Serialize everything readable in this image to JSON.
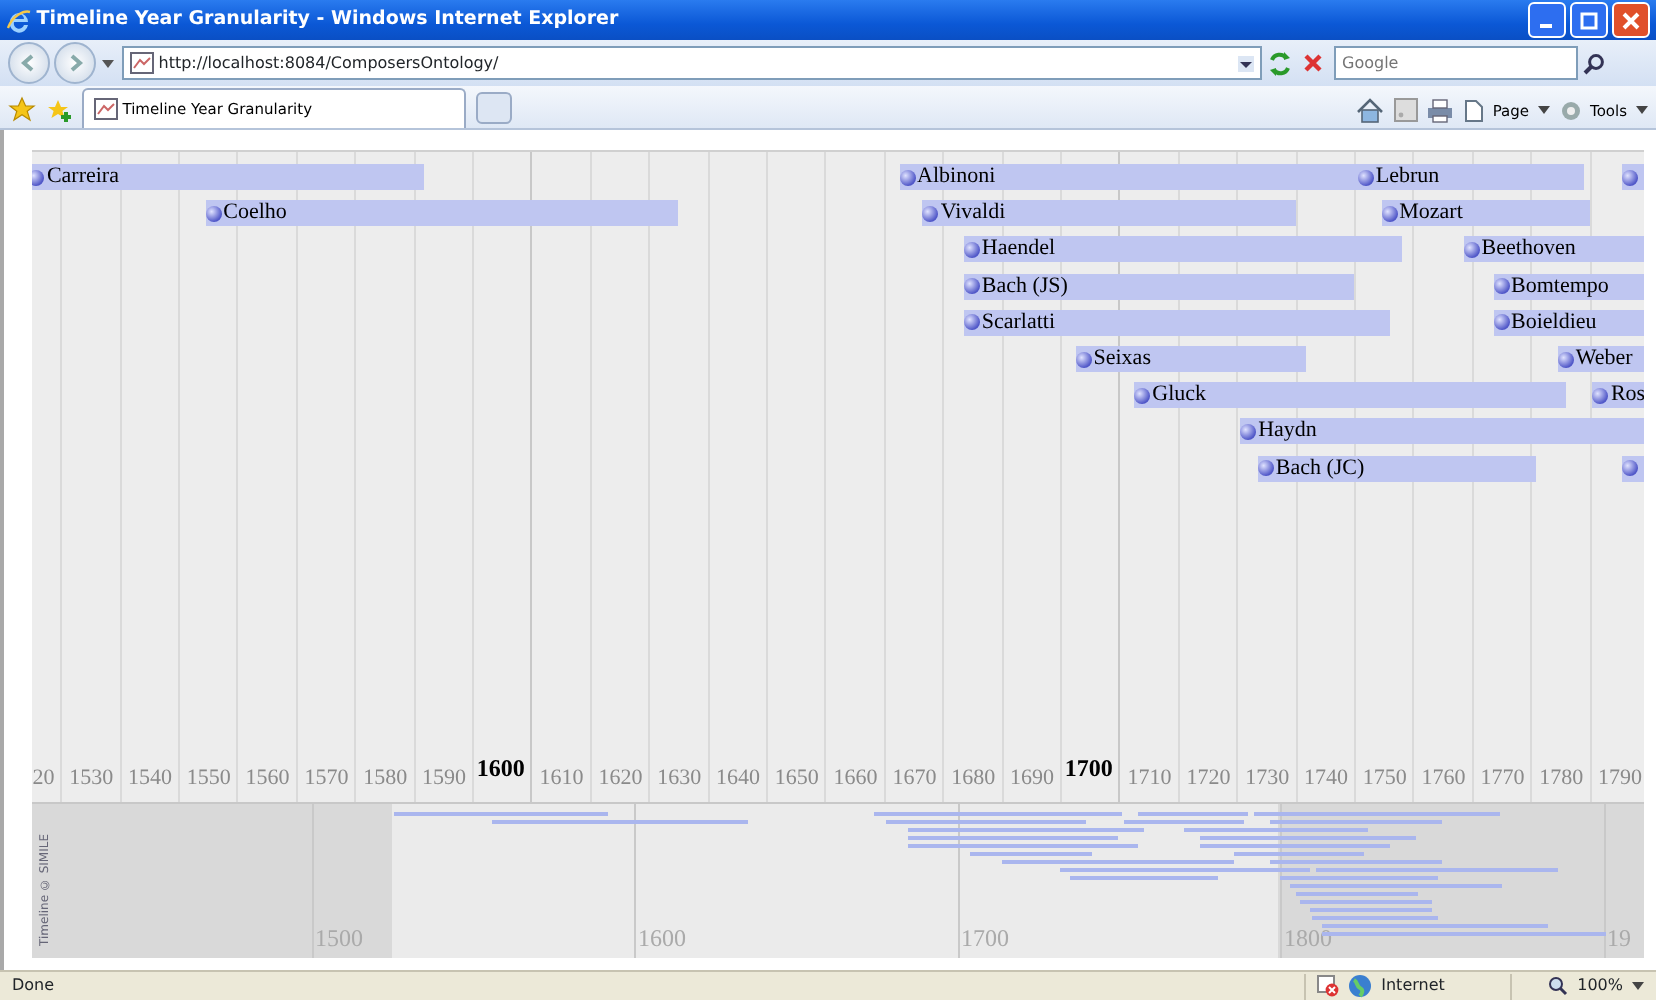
{
  "window": {
    "title": "Timeline Year Granularity - Windows Internet Explorer"
  },
  "address_bar": {
    "url": "http://localhost:8084/ComposersOntology/",
    "search_placeholder": "Google"
  },
  "tabs": [
    {
      "label": "Timeline Year Granularity",
      "selected": true
    }
  ],
  "command_bar": {
    "menus": [
      "Page",
      "Tools"
    ]
  },
  "timeline": {
    "tracks": [
      [
        {
          "kind": "labeled",
          "name": "Carreira"
        },
        {
          "kind": "labeled",
          "name": "Albinoni"
        },
        {
          "kind": "labeled",
          "name": "Lebrun"
        },
        {
          "kind": "unlabeled"
        }
      ],
      [
        {
          "kind": "labeled",
          "name": "Coelho"
        },
        {
          "kind": "labeled",
          "name": "Vivaldi"
        },
        {
          "kind": "labeled",
          "name": "Mozart"
        }
      ],
      [
        {
          "kind": "labeled",
          "name": "Haendel"
        },
        {
          "kind": "labeled",
          "name": "Beethoven"
        }
      ],
      [
        {
          "kind": "labeled",
          "name": "Bach (JS)"
        },
        {
          "kind": "labeled",
          "name": "Bomtempo"
        }
      ],
      [
        {
          "kind": "labeled",
          "name": "Scarlatti"
        },
        {
          "kind": "labeled",
          "name": "Boieldieu"
        }
      ],
      [
        {
          "kind": "labeled",
          "name": "Seixas"
        },
        {
          "kind": "labeled",
          "name": "Weber"
        }
      ],
      [
        {
          "kind": "labeled",
          "name": "Gluck"
        },
        {
          "kind": "labeled",
          "name": "Ros"
        }
      ],
      [
        {
          "kind": "labeled",
          "name": "Haydn"
        }
      ],
      [
        {
          "kind": "labeled",
          "name": "Bach (JC)"
        },
        {
          "kind": "unlabeled"
        }
      ]
    ],
    "axis_labels": [
      {
        "text": "20",
        "major": false
      },
      {
        "text": "1530",
        "major": false
      },
      {
        "text": "1540",
        "major": false
      },
      {
        "text": "1550",
        "major": false
      },
      {
        "text": "1560",
        "major": false
      },
      {
        "text": "1570",
        "major": false
      },
      {
        "text": "1580",
        "major": false
      },
      {
        "text": "1590",
        "major": false
      },
      {
        "text": "1600",
        "major": true
      },
      {
        "text": "1610",
        "major": false
      },
      {
        "text": "1620",
        "major": false
      },
      {
        "text": "1630",
        "major": false
      },
      {
        "text": "1640",
        "major": false
      },
      {
        "text": "1650",
        "major": false
      },
      {
        "text": "1660",
        "major": false
      },
      {
        "text": "1670",
        "major": false
      },
      {
        "text": "1680",
        "major": false
      },
      {
        "text": "1690",
        "major": false
      },
      {
        "text": "1700",
        "major": true
      },
      {
        "text": "1710",
        "major": false
      },
      {
        "text": "1720",
        "major": false
      },
      {
        "text": "1730",
        "major": false
      },
      {
        "text": "1740",
        "major": false
      },
      {
        "text": "1750",
        "major": false
      },
      {
        "text": "1760",
        "major": false
      },
      {
        "text": "1770",
        "major": false
      },
      {
        "text": "1780",
        "major": false
      },
      {
        "text": "1790",
        "major": false
      }
    ],
    "overview": {
      "labels": [
        "1500",
        "1600",
        "1700",
        "1800",
        "19"
      ],
      "credit": "Timeline © SIMILE"
    }
  },
  "status_bar": {
    "text": "Done",
    "zone": "Internet",
    "zoom": "100%"
  }
}
